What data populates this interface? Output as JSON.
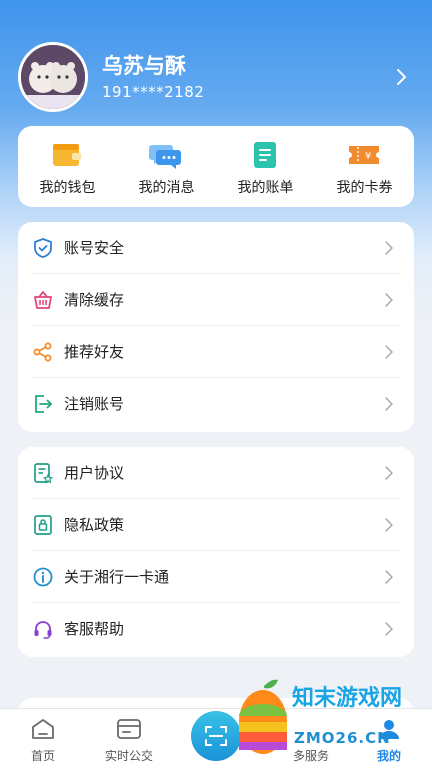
{
  "profile": {
    "name": "乌苏与酥",
    "phone": "191****2182"
  },
  "quick_actions": [
    {
      "label": "我的钱包",
      "icon": "wallet-icon",
      "color": "#f5a623"
    },
    {
      "label": "我的消息",
      "icon": "message-icon",
      "color": "#4a9ff0"
    },
    {
      "label": "我的账单",
      "icon": "bill-icon",
      "color": "#26b8a4"
    },
    {
      "label": "我的卡券",
      "icon": "coupon-icon",
      "color": "#f0822d"
    }
  ],
  "menu_group_1": [
    {
      "label": "账号安全",
      "icon": "shield-icon"
    },
    {
      "label": "清除缓存",
      "icon": "basket-icon"
    },
    {
      "label": "推荐好友",
      "icon": "share-icon"
    },
    {
      "label": "注销账号",
      "icon": "logout-icon"
    }
  ],
  "menu_group_2": [
    {
      "label": "用户协议",
      "icon": "agreement-icon"
    },
    {
      "label": "隐私政策",
      "icon": "privacy-icon"
    },
    {
      "label": "关于湘行一卡通",
      "icon": "info-icon"
    },
    {
      "label": "客服帮助",
      "icon": "headset-icon"
    }
  ],
  "tabbar": {
    "home": "首页",
    "realtime_bus": "实时公交",
    "more_services": "多服务",
    "mine": "我的",
    "active_color": "#1e88e5"
  },
  "watermark": {
    "line1": "知末游戏网",
    "line2": "ZMO26.CN"
  }
}
